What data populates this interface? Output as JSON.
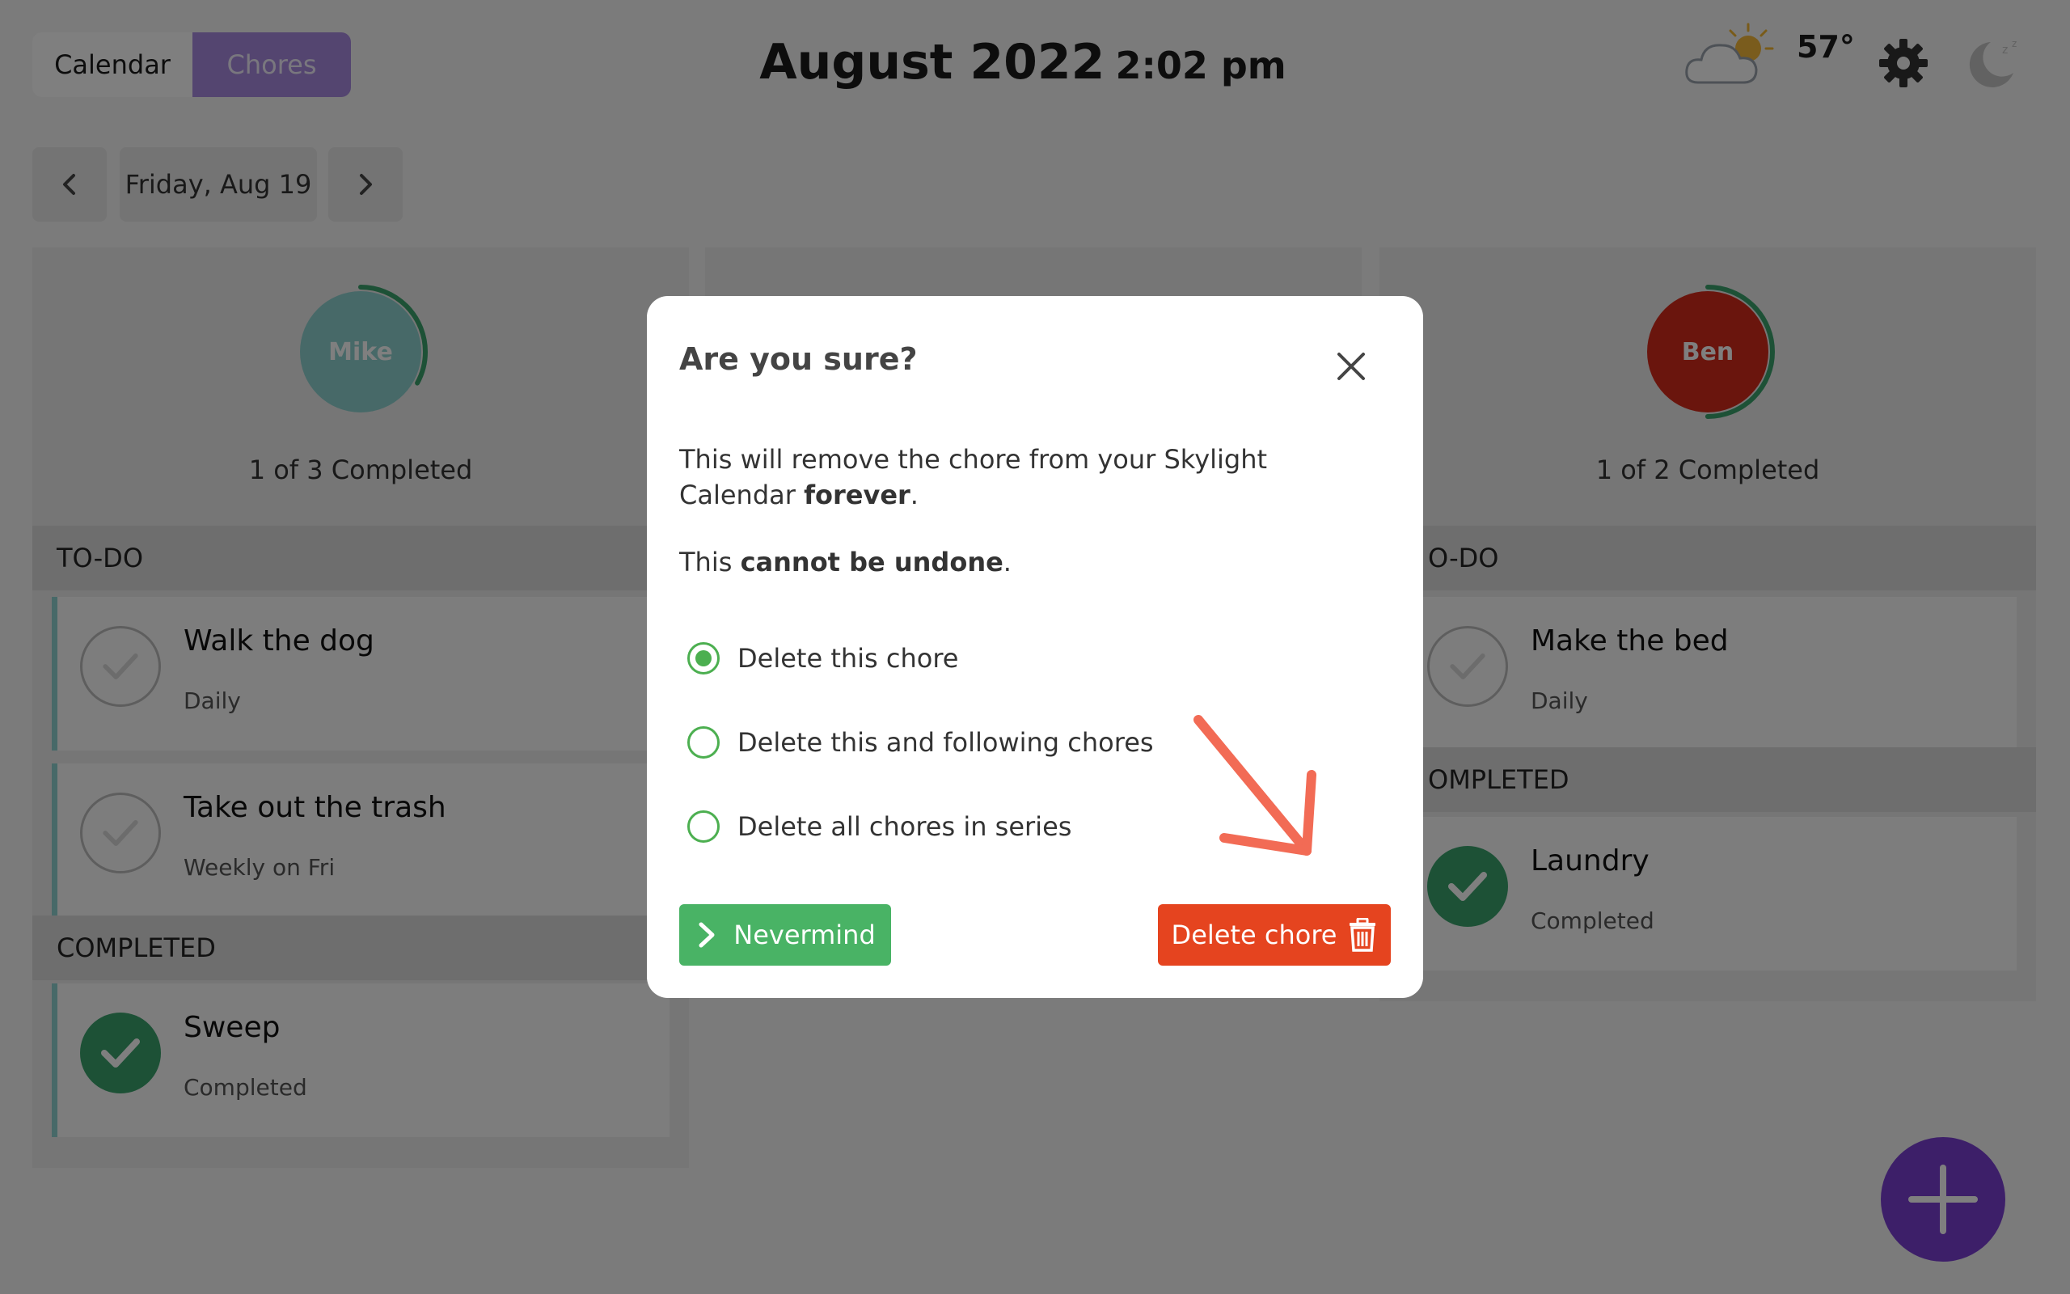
{
  "tabs": {
    "calendar": "Calendar",
    "chores": "Chores"
  },
  "header": {
    "month": "August 2022",
    "time": "2:02 pm",
    "temperature": "57°"
  },
  "date_nav": {
    "label": "Friday, Aug 19"
  },
  "columns": {
    "mike": {
      "name": "Mike",
      "avatar_color": "#8fd3d1",
      "progress": "1 of 3 Completed",
      "completed_fraction": 0.33,
      "todo_label": "TO-DO",
      "completed_label": "COMPLETED",
      "todo": [
        {
          "title": "Walk the dog",
          "sub": "Daily"
        },
        {
          "title": "Take out the trash",
          "sub": "Weekly on Fri"
        }
      ],
      "completed": [
        {
          "title": "Sweep",
          "sub": "Completed"
        }
      ]
    },
    "ben": {
      "name": "Ben",
      "avatar_color": "#d42a1a",
      "progress": "1 of 2 Completed",
      "completed_fraction": 0.5,
      "todo_label": "O-DO",
      "completed_label": "OMPLETED",
      "todo": [
        {
          "title": "Make the bed",
          "sub": "Daily"
        }
      ],
      "completed": [
        {
          "title": "Laundry",
          "sub": "Completed"
        }
      ]
    }
  },
  "modal": {
    "title": "Are you sure?",
    "body_line1": "This will remove the chore from your Skylight Calendar ",
    "body_bold1": "forever",
    "body_end1": ".",
    "body_line2": "This ",
    "body_bold2": "cannot be undone",
    "body_end2": ".",
    "options": [
      {
        "label": "Delete this chore",
        "checked": true
      },
      {
        "label": "Delete this and following chores",
        "checked": false
      },
      {
        "label": "Delete all chores in series",
        "checked": false
      }
    ],
    "nevermind_label": "Nevermind",
    "delete_label": "Delete chore"
  },
  "colors": {
    "accent_purple": "#7b3fd2",
    "success_green": "#49b365",
    "danger_red": "#e5441f",
    "hint_arrow": "#f26b55"
  }
}
